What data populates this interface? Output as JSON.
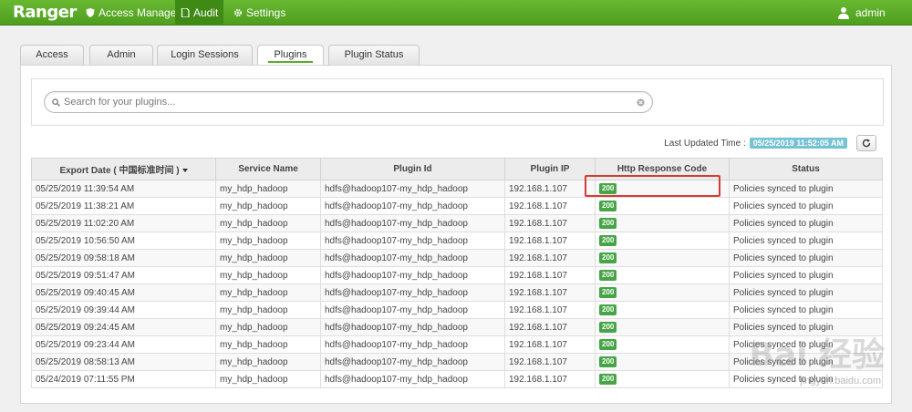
{
  "app": {
    "brand": "Ranger"
  },
  "nav": {
    "access_manager": "Access Manager",
    "audit": "Audit",
    "settings": "Settings",
    "user": "admin"
  },
  "tabs": [
    "Access",
    "Admin",
    "Login Sessions",
    "Plugins",
    "Plugin Status"
  ],
  "active_tab": "Plugins",
  "search": {
    "placeholder": "Search for your plugins..."
  },
  "last_updated": {
    "label": "Last Updated Time :",
    "value": "05/25/2019 11:52:05 AM"
  },
  "table": {
    "columns": [
      "Export Date ( 中国标准时间 )",
      "Service Name",
      "Plugin Id",
      "Plugin IP",
      "Http Response Code",
      "Status"
    ],
    "rows": [
      [
        "05/25/2019 11:39:54 AM",
        "my_hdp_hadoop",
        "hdfs@hadoop107-my_hdp_hadoop",
        "192.168.1.107",
        "200",
        "Policies synced to plugin"
      ],
      [
        "05/25/2019 11:38:21 AM",
        "my_hdp_hadoop",
        "hdfs@hadoop107-my_hdp_hadoop",
        "192.168.1.107",
        "200",
        "Policies synced to plugin"
      ],
      [
        "05/25/2019 11:02:20 AM",
        "my_hdp_hadoop",
        "hdfs@hadoop107-my_hdp_hadoop",
        "192.168.1.107",
        "200",
        "Policies synced to plugin"
      ],
      [
        "05/25/2019 10:56:50 AM",
        "my_hdp_hadoop",
        "hdfs@hadoop107-my_hdp_hadoop",
        "192.168.1.107",
        "200",
        "Policies synced to plugin"
      ],
      [
        "05/25/2019 09:58:18 AM",
        "my_hdp_hadoop",
        "hdfs@hadoop107-my_hdp_hadoop",
        "192.168.1.107",
        "200",
        "Policies synced to plugin"
      ],
      [
        "05/25/2019 09:51:47 AM",
        "my_hdp_hadoop",
        "hdfs@hadoop107-my_hdp_hadoop",
        "192.168.1.107",
        "200",
        "Policies synced to plugin"
      ],
      [
        "05/25/2019 09:40:45 AM",
        "my_hdp_hadoop",
        "hdfs@hadoop107-my_hdp_hadoop",
        "192.168.1.107",
        "200",
        "Policies synced to plugin"
      ],
      [
        "05/25/2019 09:39:44 AM",
        "my_hdp_hadoop",
        "hdfs@hadoop107-my_hdp_hadoop",
        "192.168.1.107",
        "200",
        "Policies synced to plugin"
      ],
      [
        "05/25/2019 09:24:45 AM",
        "my_hdp_hadoop",
        "hdfs@hadoop107-my_hdp_hadoop",
        "192.168.1.107",
        "200",
        "Policies synced to plugin"
      ],
      [
        "05/25/2019 09:23:44 AM",
        "my_hdp_hadoop",
        "hdfs@hadoop107-my_hdp_hadoop",
        "192.168.1.107",
        "200",
        "Policies synced to plugin"
      ],
      [
        "05/25/2019 08:58:13 AM",
        "my_hdp_hadoop",
        "hdfs@hadoop107-my_hdp_hadoop",
        "192.168.1.107",
        "200",
        "Policies synced to plugin"
      ],
      [
        "05/24/2019 07:11:55 PM",
        "my_hdp_hadoop",
        "hdfs@hadoop107-my_hdp_hadoop",
        "192.168.1.107",
        "200",
        "Policies synced to plugin"
      ]
    ]
  },
  "watermark": {
    "text": "Bai 经验",
    "url": "jingyan.baidu.com"
  },
  "colors": {
    "brand_green": "#5aad26",
    "badge_green": "#46a546",
    "highlight_red": "#d63b33",
    "timestamp_badge": "#74c2d4"
  }
}
